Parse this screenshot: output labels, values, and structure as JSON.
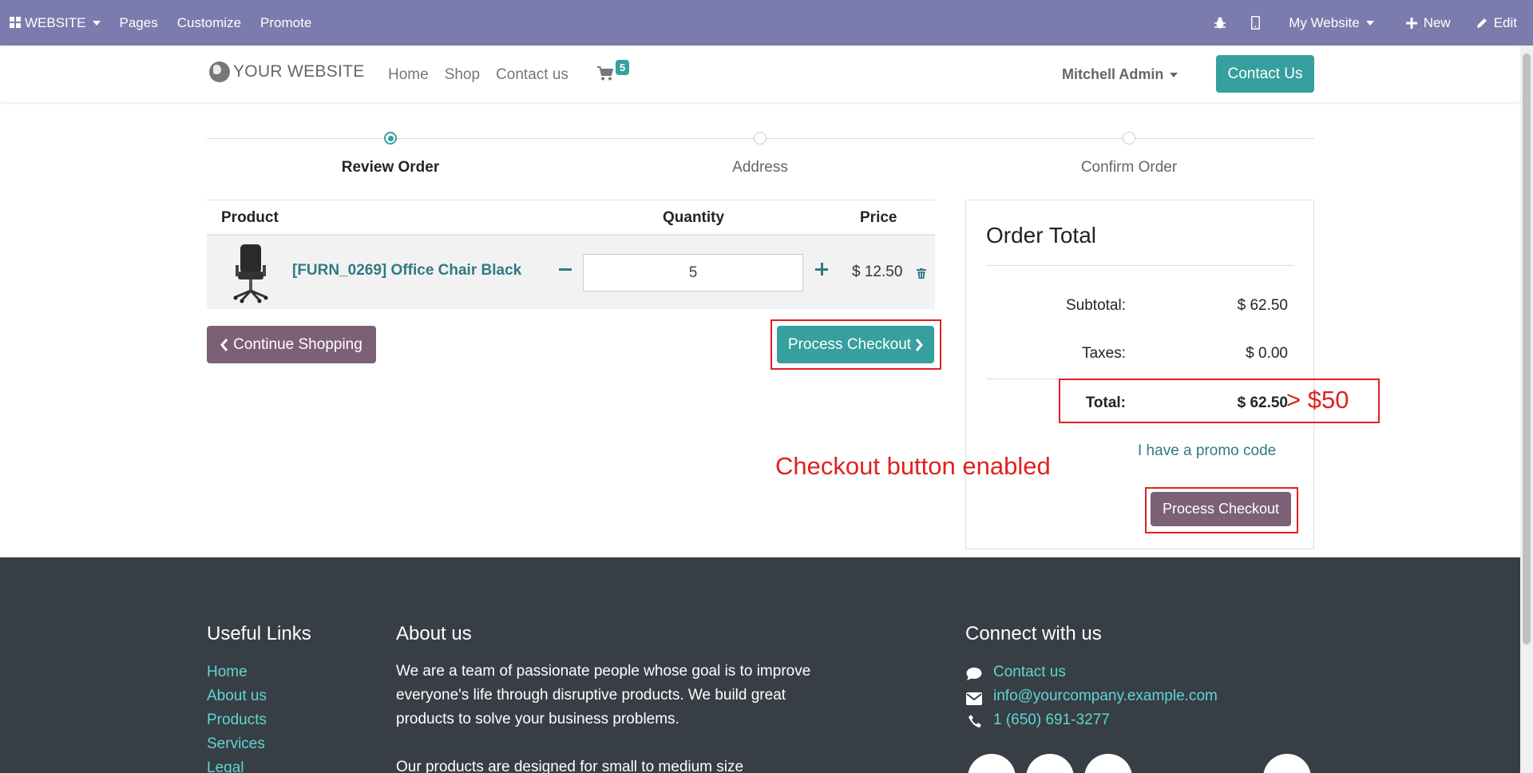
{
  "admin_bar": {
    "brand_label": "WEBSITE",
    "pages": "Pages",
    "customize": "Customize",
    "promote": "Promote",
    "website_selector": "My Website",
    "new_label": "New",
    "edit_label": "Edit"
  },
  "site_nav": {
    "logo_text": "YOUR WEBSITE",
    "links": [
      "Home",
      "Shop",
      "Contact us"
    ],
    "cart_count": "5",
    "user_name": "Mitchell Admin",
    "contact_button": "Contact Us"
  },
  "wizard": {
    "steps": [
      "Review Order",
      "Address",
      "Confirm Order"
    ],
    "active_step": 0
  },
  "cart": {
    "headers": {
      "product": "Product",
      "quantity": "Quantity",
      "price": "Price"
    },
    "items": [
      {
        "name": "[FURN_0269] Office Chair Black",
        "quantity": "5",
        "price": "$ 12.50"
      }
    ],
    "continue_label": "Continue Shopping",
    "checkout_label": "Process Checkout"
  },
  "order_total": {
    "title": "Order Total",
    "subtotal_label": "Subtotal:",
    "subtotal_value": "$ 62.50",
    "taxes_label": "Taxes:",
    "taxes_value": "$ 0.00",
    "total_label": "Total:",
    "total_value": "$ 62.50",
    "promo_link": "I have a promo code",
    "checkout_label": "Process Checkout"
  },
  "annotations": {
    "total_note": "> $50",
    "checkout_note": "Checkout button enabled"
  },
  "footer": {
    "useful_links_title": "Useful Links",
    "useful_links": [
      "Home",
      "About us",
      "Products",
      "Services",
      "Legal"
    ],
    "about_title": "About us",
    "about_lines": [
      "We are a team of passionate people whose goal is to improve",
      "everyone's life through disruptive products. We build great",
      "products to solve your business problems.",
      "",
      "Our products are designed for small to medium size"
    ],
    "connect_title": "Connect with us",
    "contact_link": "Contact us",
    "email": "info@yourcompany.example.com",
    "phone": "1 (650) 691-3277"
  },
  "colors": {
    "admin_bar": "#7c7bad",
    "accent_teal": "#35a09d",
    "secondary_purple": "#7c6076",
    "annotation_red": "#e02020",
    "footer_bg": "#383e45"
  }
}
